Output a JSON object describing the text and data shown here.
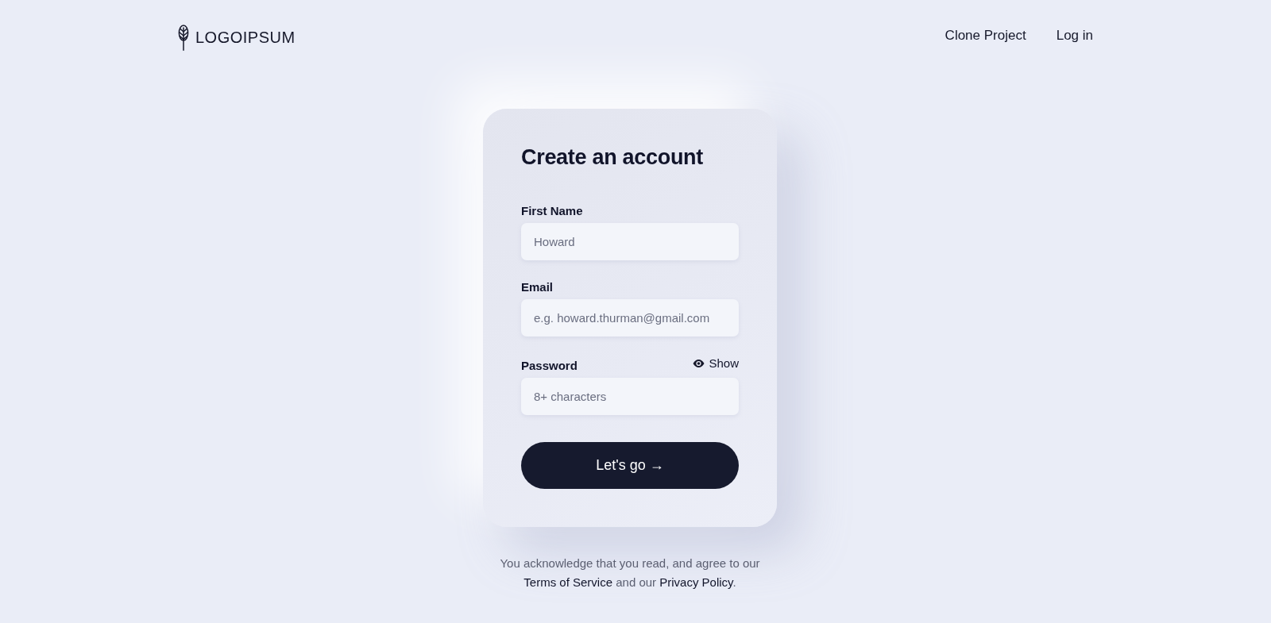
{
  "header": {
    "logo": {
      "text": "LOGOIPSUM"
    },
    "nav": [
      {
        "label": "Clone Project"
      },
      {
        "label": "Log in"
      }
    ]
  },
  "card": {
    "title": "Create an account",
    "fields": [
      {
        "label": "First Name",
        "placeholder": "Howard"
      },
      {
        "label": "Email",
        "placeholder": "e.g. howard.thurman@gmail.com"
      },
      {
        "label": "Password",
        "placeholder": "8+ characters",
        "toggle": {
          "label": "Show"
        }
      }
    ],
    "submit": {
      "label": "Let's go →"
    }
  },
  "legal": {
    "parts": [
      {
        "kind": "text",
        "text": "You acknowledge that you read, and agree to our "
      },
      {
        "kind": "link",
        "text": "Terms of Service"
      },
      {
        "kind": "text",
        "text": " and our "
      },
      {
        "kind": "link",
        "text": "Privacy Policy"
      },
      {
        "kind": "text",
        "text": "."
      }
    ]
  }
}
